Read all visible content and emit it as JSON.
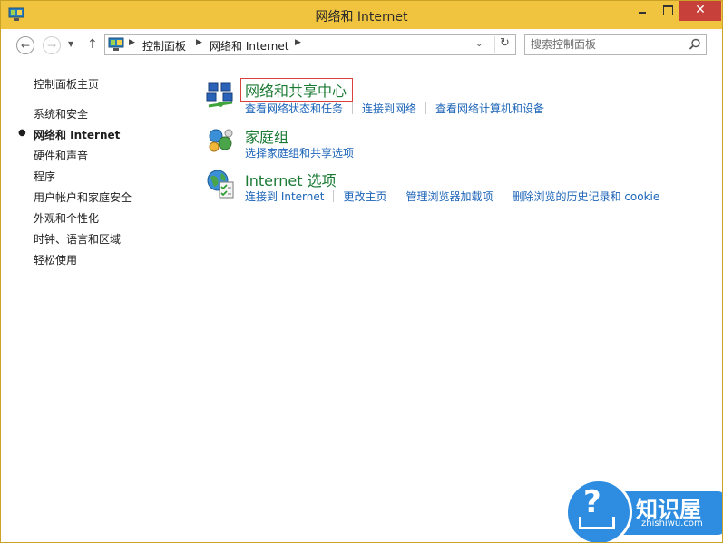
{
  "window": {
    "title": "网络和 Internet"
  },
  "titlebar": {
    "close_glyph": "✕",
    "colors": {
      "frame": "#f0c43e",
      "close": "#c7413a"
    }
  },
  "nav": {
    "back_glyph": "←",
    "forward_glyph": "→",
    "recent_glyph": "▼",
    "up_glyph": "↑",
    "breadcrumbs": [
      "控制面板",
      "网络和 Internet"
    ],
    "separator_glyph": "▶",
    "dropdown_glyph": "⌄",
    "refresh_glyph": "↻",
    "search_placeholder": "搜索控制面板"
  },
  "sidebar": {
    "bullet": "●",
    "items": [
      {
        "label": "控制面板主页"
      },
      {
        "label": "系统和安全"
      },
      {
        "label": "网络和 Internet",
        "active": true
      },
      {
        "label": "硬件和声音"
      },
      {
        "label": "程序"
      },
      {
        "label": "用户帐户和家庭安全"
      },
      {
        "label": "外观和个性化"
      },
      {
        "label": "时钟、语言和区域"
      },
      {
        "label": "轻松使用"
      }
    ]
  },
  "categories": [
    {
      "title": "网络和共享中心",
      "icon": "network-sharing-icon",
      "links": [
        "查看网络状态和任务",
        "连接到网络",
        "查看网络计算机和设备"
      ]
    },
    {
      "title": "家庭组",
      "icon": "homegroup-icon",
      "links": [
        "选择家庭组和共享选项"
      ]
    },
    {
      "title": "Internet 选项",
      "icon": "internet-options-icon",
      "links": [
        "连接到 Internet",
        "更改主页",
        "管理浏览器加载项",
        "删除浏览的历史记录和 cookie"
      ]
    }
  ],
  "watermark": {
    "title": "知识屋",
    "subtitle": "zhishiwu.com",
    "glyph": "?",
    "color": "#2e8de0"
  },
  "colors": {
    "link": "#1c64b8",
    "category_title": "#1a7a34",
    "highlight_border": "#d9413d"
  }
}
